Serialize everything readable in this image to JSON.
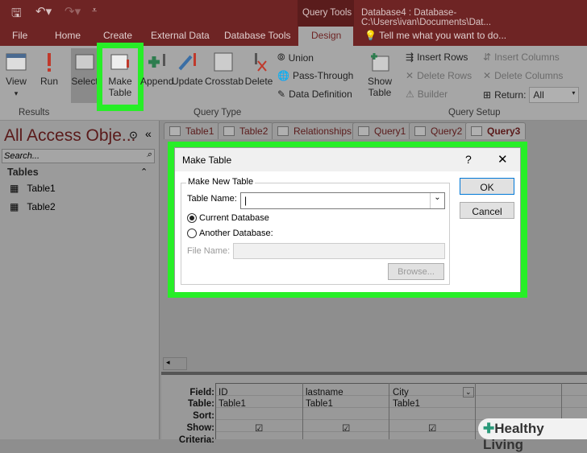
{
  "titlebar": {
    "context_tab": "Query Tools",
    "title": "Database4 : Database- C:\\Users\\ivan\\Documents\\Dat..."
  },
  "tabs": [
    "File",
    "Home",
    "Create",
    "External Data",
    "Database Tools",
    "Design"
  ],
  "tell_me": "Tell me what you want to do...",
  "ribbon": {
    "results": {
      "view": "View",
      "run": "Run",
      "label": "Results"
    },
    "query_type": {
      "select": "Select",
      "make_table": [
        "Make",
        "Table"
      ],
      "append": "Append",
      "update": "Update",
      "crosstab": "Crosstab",
      "delete": "Delete",
      "union": "Union",
      "pass_through": "Pass-Through",
      "data_definition": "Data Definition",
      "label": "Query Type"
    },
    "query_setup": {
      "show_table": [
        "Show",
        "Table"
      ],
      "insert_rows": "Insert Rows",
      "delete_rows": "Delete Rows",
      "builder": "Builder",
      "insert_columns": "Insert Columns",
      "delete_columns": "Delete Columns",
      "return_label": "Return:",
      "return_value": "All",
      "label": "Query Setup"
    }
  },
  "nav": {
    "title": "All Access Obje...",
    "search_placeholder": "Search...",
    "section": "Tables",
    "items": [
      "Table1",
      "Table2"
    ]
  },
  "doc_tabs": [
    "Table1",
    "Table2",
    "Relationships",
    "Query1",
    "Query2",
    "Query3"
  ],
  "dialog": {
    "title": "Make Table",
    "help": "?",
    "close": "✕",
    "group": "Make New Table",
    "table_name_label": "Table Name:",
    "table_name_value": "",
    "current_db": "Current Database",
    "another_db": "Another Database:",
    "file_name_label": "File Name:",
    "file_name_value": "",
    "browse": "Browse...",
    "ok": "OK",
    "cancel": "Cancel"
  },
  "grid": {
    "row_labels": [
      "Field:",
      "Table:",
      "Sort:",
      "Show:",
      "Criteria:"
    ],
    "columns": [
      {
        "field": "ID",
        "table": "Table1",
        "show": true
      },
      {
        "field": "lastname",
        "table": "Table1",
        "show": true
      },
      {
        "field": "City",
        "table": "Table1",
        "show": true
      }
    ]
  },
  "watermark": "Healthy Living"
}
